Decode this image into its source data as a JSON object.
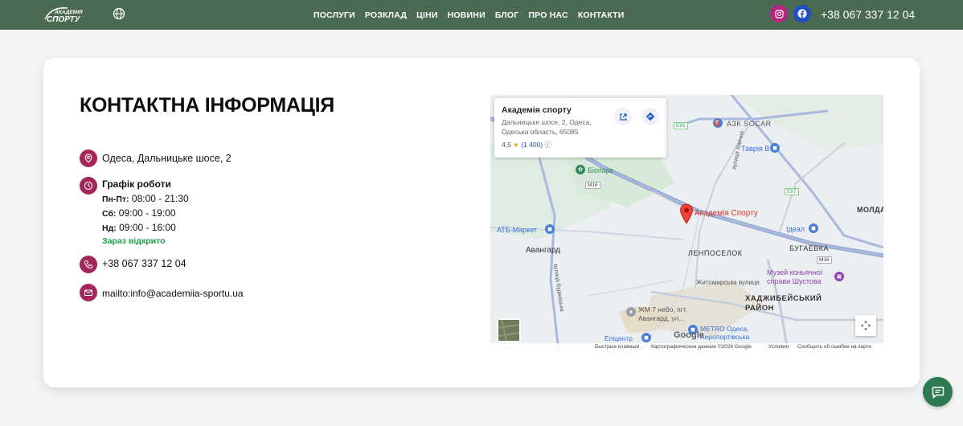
{
  "header": {
    "logo_text": "АКАДЕМІЯ СПОРТУ",
    "nav": [
      "ПОСЛУГИ",
      "РОЗКЛАД",
      "ЦІНИ",
      "НОВИНИ",
      "БЛОГ",
      "ПРО НАС",
      "КОНТАКТИ"
    ],
    "phone": "+38 067 337 12 04",
    "socials": [
      "instagram-icon",
      "facebook-icon"
    ]
  },
  "contact": {
    "title": "КОНТАКТНА ІНФОРМАЦІЯ",
    "address": "Одеса, Дальницьке шосе, 2",
    "schedule_title": "Графік роботи",
    "schedule": [
      {
        "day": "Пн-Пт:",
        "time": "08:00 - 21:30"
      },
      {
        "day": "Сб:",
        "time": "09:00 - 19:00"
      },
      {
        "day": "Нд:",
        "time": "09:00 - 16:00"
      }
    ],
    "open_status": "Зараз відкрито",
    "phone": "+38 067 337 12 04",
    "email": "mailto:info@academiia-sportu.ua"
  },
  "map": {
    "place_name": "Академія спорту",
    "place_address": "Дальницьке шосе, 2, Одеса, Одеська область, 65085",
    "rating": "4,5",
    "reviews": "(1 400)",
    "pin_label": "Академія Спорту",
    "labels": {
      "azs": "АЗК SOCAR",
      "tavria": "Таврія В",
      "bioprak": "Біопарк",
      "atb": "АТБ-Маркет",
      "ideal": "Ідеал",
      "molda": "МОЛДА",
      "bugaevka": "БУГАЕВКА",
      "avangard": "Авангард",
      "lenposelok": "ЛЕНПОСЕЛОК",
      "museum": "Музей коньячної справи Шустова",
      "zhytomyrska": "Житомирська вулиця",
      "hadzhibey": "ХАДЖИБЕЙСЬКИЙ РАЙОН",
      "zhm": "ЖМ 7 небо, пгт. Авангард, ул...",
      "metro": "METRO Одеса, Аеропортівська",
      "epicentr": "Епіцентр",
      "budzhak": "вулиця Буджацька",
      "khimichna": "вулиця Хімічна",
      "m16": "M16",
      "e95": "E95",
      "e87": "E87"
    },
    "google": "Google",
    "attribution": [
      "Быстрые клавиши",
      "Картографические данные ©2026 Google",
      "Условия",
      "Сообщить об ошибке на карте"
    ]
  }
}
